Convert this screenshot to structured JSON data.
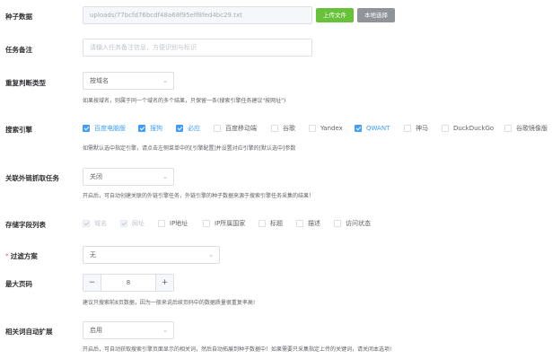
{
  "seed": {
    "label": "种子数据",
    "path": "uploads/77bcfd76bcdf48a68f95eff8fed4bc29.txt",
    "upload_button": "上传文件",
    "local_button": "本地选择"
  },
  "remark": {
    "label": "任务备注",
    "placeholder": "请输入任务备注信息，方便识别与标识"
  },
  "repeat_type": {
    "label": "重复判断类型",
    "value": "按域名",
    "help": "如果按域名，则属于同一个域名的多个结果，只保留一条(搜索引擎任务建议\"按网址\")"
  },
  "engines": {
    "label": "搜索引擎",
    "items": [
      {
        "label": "百度电脑版",
        "checked": true
      },
      {
        "label": "搜狗",
        "checked": true
      },
      {
        "label": "必应",
        "checked": true
      },
      {
        "label": "百度移动端",
        "checked": false
      },
      {
        "label": "谷歌",
        "checked": false
      },
      {
        "label": "Yandex",
        "checked": false
      },
      {
        "label": "QWANT",
        "checked": true
      },
      {
        "label": "神马",
        "checked": false
      },
      {
        "label": "DuckDuckGo",
        "checked": false
      },
      {
        "label": "谷歌镜像版",
        "checked": false
      }
    ],
    "help": "如需默认选中指定引擎，请点击左侧菜单中的[引擎配置]并设置对应引擎的[默认选中]参数"
  },
  "external": {
    "label": "关联外链抓取任务",
    "value": "关闭",
    "help": "开启后，可自动创建关联的外链引擎任务，外链引擎的种子数据来源于搜索引擎任务采集的结果！"
  },
  "fields": {
    "label": "存储字段列表",
    "items": [
      {
        "label": "域名",
        "checked": true,
        "disabled": true
      },
      {
        "label": "网址",
        "checked": true,
        "disabled": true
      },
      {
        "label": "IP地址",
        "checked": false,
        "disabled": false
      },
      {
        "label": "IP所属国家",
        "checked": false,
        "disabled": false
      },
      {
        "label": "标题",
        "checked": false,
        "disabled": false
      },
      {
        "label": "描述",
        "checked": false,
        "disabled": false
      },
      {
        "label": "访问状态",
        "checked": false,
        "disabled": false
      }
    ]
  },
  "filter": {
    "label": "过滤方案",
    "required": "*",
    "value": "无"
  },
  "max_pages": {
    "label": "最大页码",
    "minus": "−",
    "value": "8",
    "plus": "+",
    "help": "建议只搜索前8页数据，因为一般来说后续页码中的数据质量很重复率高!"
  },
  "auto_expand": {
    "label": "相关词自动扩展",
    "value": "启用",
    "help": "开启后，可自动获取搜索引擎页面显示的相关词，然后自动拓展到种子数据中！如果需要只采集指定上传的关键词，请关闭本选项!"
  },
  "icons": {
    "dropdown": "chevron-down-icon",
    "check": "check-icon"
  },
  "colors": {
    "primary": "#409eff",
    "success": "#67c23a",
    "info": "#909399",
    "danger": "#f56c6c"
  }
}
